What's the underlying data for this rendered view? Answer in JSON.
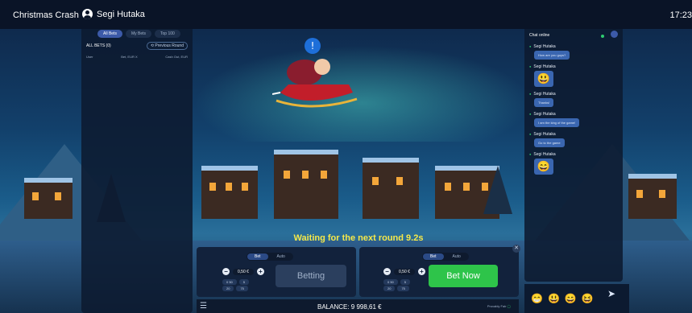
{
  "header": {
    "title": "Christmas Crash",
    "user": "Segi Hutaka",
    "time": "17:23"
  },
  "bets": {
    "tabs": [
      "All Bets",
      "My Bets",
      "Top 100"
    ],
    "active_tab": 0,
    "all_bets_label": "ALL BETS (0)",
    "previous_round": "Previous Round",
    "col_user": "User",
    "col_bet": "Bet, EUR",
    "col_x": "X",
    "col_cashout": "Cash Out, EUR"
  },
  "chat": {
    "title": "Chat online",
    "messages": [
      {
        "user": "Segi Hutaka",
        "text": "How are you guys?"
      },
      {
        "user": "Segi Hutaka",
        "emoji": "😃"
      },
      {
        "user": "Segi Hutaka",
        "text": "Thanks!"
      },
      {
        "user": "Segi Hutaka",
        "text": "I am the king of the game!"
      },
      {
        "user": "Segi Hutaka",
        "text": "Go to the game"
      },
      {
        "user": "Segi Hutaka",
        "emoji": "😄"
      }
    ],
    "emoji_bar": [
      "😁",
      "😃",
      "😄",
      "😆",
      "😊"
    ]
  },
  "game": {
    "status": "Waiting for the next round 9.2s"
  },
  "bet_panel_left": {
    "mode_tabs": [
      "Bet",
      "Auto"
    ],
    "active_mode": 0,
    "stake": "0,50 €",
    "quick": [
      "0 50",
      "5",
      "20",
      "75"
    ],
    "action_label": "Betting"
  },
  "bet_panel_right": {
    "mode_tabs": [
      "Bet",
      "Auto"
    ],
    "active_mode": 0,
    "stake": "0,50 €",
    "quick": [
      "0 50",
      "5",
      "20",
      "75"
    ],
    "action_label": "Bet Now"
  },
  "footer": {
    "balance": "BALANCE: 9 998,61 €",
    "provably_fair": "Provably Fair"
  }
}
